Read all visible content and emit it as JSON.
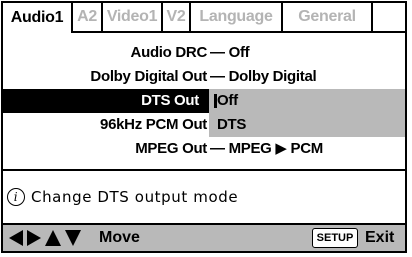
{
  "tabs": [
    {
      "label": "Audio1",
      "active": true
    },
    {
      "label": "A2",
      "active": false
    },
    {
      "label": "Video1",
      "active": false
    },
    {
      "label": "V2",
      "active": false
    },
    {
      "label": "Language",
      "active": false
    },
    {
      "label": "General",
      "active": false
    }
  ],
  "settings": [
    {
      "label": "Audio DRC",
      "separator": "—",
      "value": "Off"
    },
    {
      "label": "Dolby Digital Out",
      "separator": "—",
      "value": "Dolby Digital"
    },
    {
      "label": "DTS Out",
      "options": [
        "Off",
        "DTS"
      ],
      "selected": "Off"
    },
    {
      "label": "96kHz PCM Out",
      "value": ""
    },
    {
      "label": "MPEG Out",
      "separator": "—",
      "value": "MPEG ▶ PCM"
    }
  ],
  "info": {
    "icon": "info-icon",
    "text": "Change DTS output mode"
  },
  "footer": {
    "nav_icons": [
      "left-arrow-icon",
      "right-arrow-icon",
      "up-arrow-icon",
      "down-arrow-icon"
    ],
    "move_label": "Move",
    "setup_label": "SETUP",
    "exit_label": "Exit"
  },
  "colors": {
    "highlight": "#000000",
    "option_panel": "#b9b9b9",
    "inactive_tab": "#b4b4b4"
  }
}
